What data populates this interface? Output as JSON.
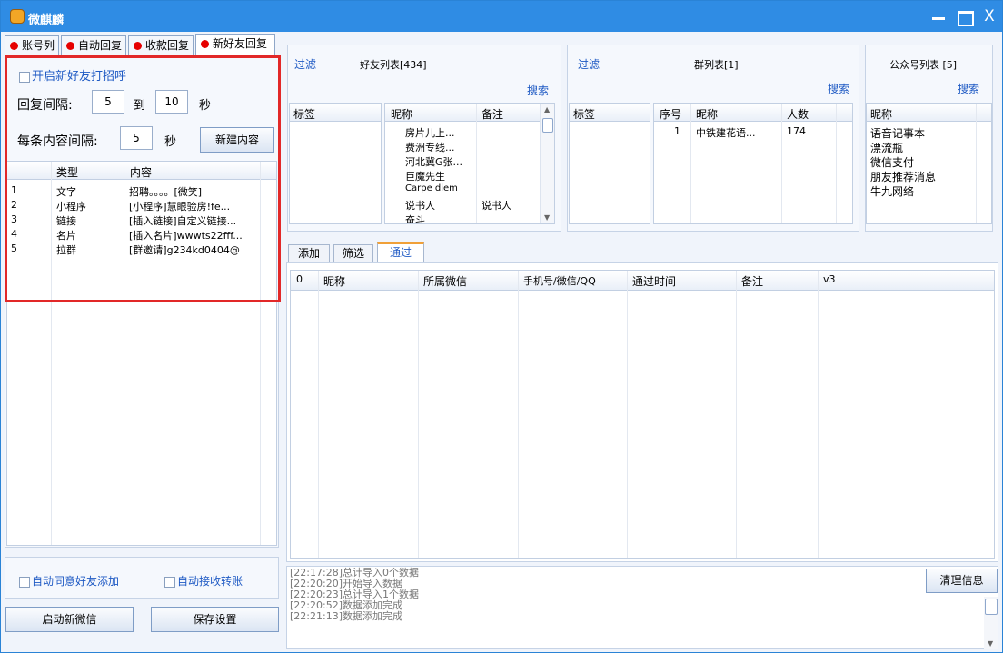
{
  "title": "微麒麟",
  "window_controls": {
    "minimize": "",
    "maximize": "",
    "close": "X"
  },
  "tabs": [
    "账号列",
    "自动回复",
    "收款回复",
    "新好友回复"
  ],
  "greet": {
    "enable_label": "开启新好友打招呼",
    "interval_label": "回复间隔:",
    "interval_from": "5",
    "to_label": "到",
    "interval_to": "10",
    "sec_label": "秒",
    "content_interval_label": "每条内容间隔:",
    "content_interval": "5",
    "sec_label2": "秒",
    "new_content_button": "新建内容"
  },
  "content_table": {
    "headers": [
      "类型",
      "内容"
    ],
    "rows": [
      [
        "1",
        "文字",
        "招聘。。。。[微笑]"
      ],
      [
        "2",
        "小程序",
        "[小程序]慧眼验房!fe..."
      ],
      [
        "3",
        "链接",
        "[插入链接]自定义链接..."
      ],
      [
        "4",
        "名片",
        "[插入名片]wwwts22fff..."
      ],
      [
        "5",
        "拉群",
        "[群邀请]g234kd0404@"
      ]
    ]
  },
  "bottom_left": {
    "auto_accept": "自动同意好友添加",
    "auto_receive": "自动接收转账",
    "start_button": "启动新微信",
    "save_button": "保存设置"
  },
  "friends": {
    "filter": "过滤",
    "title": "好友列表[434]",
    "search": "搜索",
    "tag_header": "标签",
    "headers": [
      "昵称",
      "备注"
    ],
    "rows": [
      [
        "房片儿上...",
        ""
      ],
      [
        "费洲专线...",
        ""
      ],
      [
        "河北冀G张...",
        ""
      ],
      [
        "巨魔先生",
        ""
      ],
      [
        "Carpe diem",
        ""
      ],
      [
        "说书人",
        "说书人"
      ],
      [
        "奋斗",
        ""
      ]
    ]
  },
  "groups": {
    "filter": "过滤",
    "title": "群列表[1]",
    "search": "搜索",
    "tag_header": "标签",
    "headers": [
      "序号",
      "昵称",
      "人数"
    ],
    "rows": [
      [
        "1",
        "中铁建花语...",
        "174"
      ]
    ]
  },
  "official": {
    "title": "公众号列表 [5]",
    "search": "搜索",
    "header": "昵称",
    "rows": [
      "语音记事本",
      "漂流瓶",
      "微信支付",
      "朋友推荐消息",
      "牛九网络"
    ]
  },
  "lower_tabs": [
    "添加",
    "筛选",
    "通过"
  ],
  "pass_table": {
    "headers": [
      "0",
      "昵称",
      "所属微信",
      "手机号/微信/QQ",
      "通过时间",
      "备注",
      "v3"
    ]
  },
  "log": {
    "lines": [
      "[22:17:28]总计导入0个数据",
      "[22:20:20]开始导入数据",
      "[22:20:23]总计导入1个数据",
      "[22:20:52]数据添加完成",
      "[22:21:13]数据添加完成"
    ],
    "clear_button": "清理信息"
  }
}
